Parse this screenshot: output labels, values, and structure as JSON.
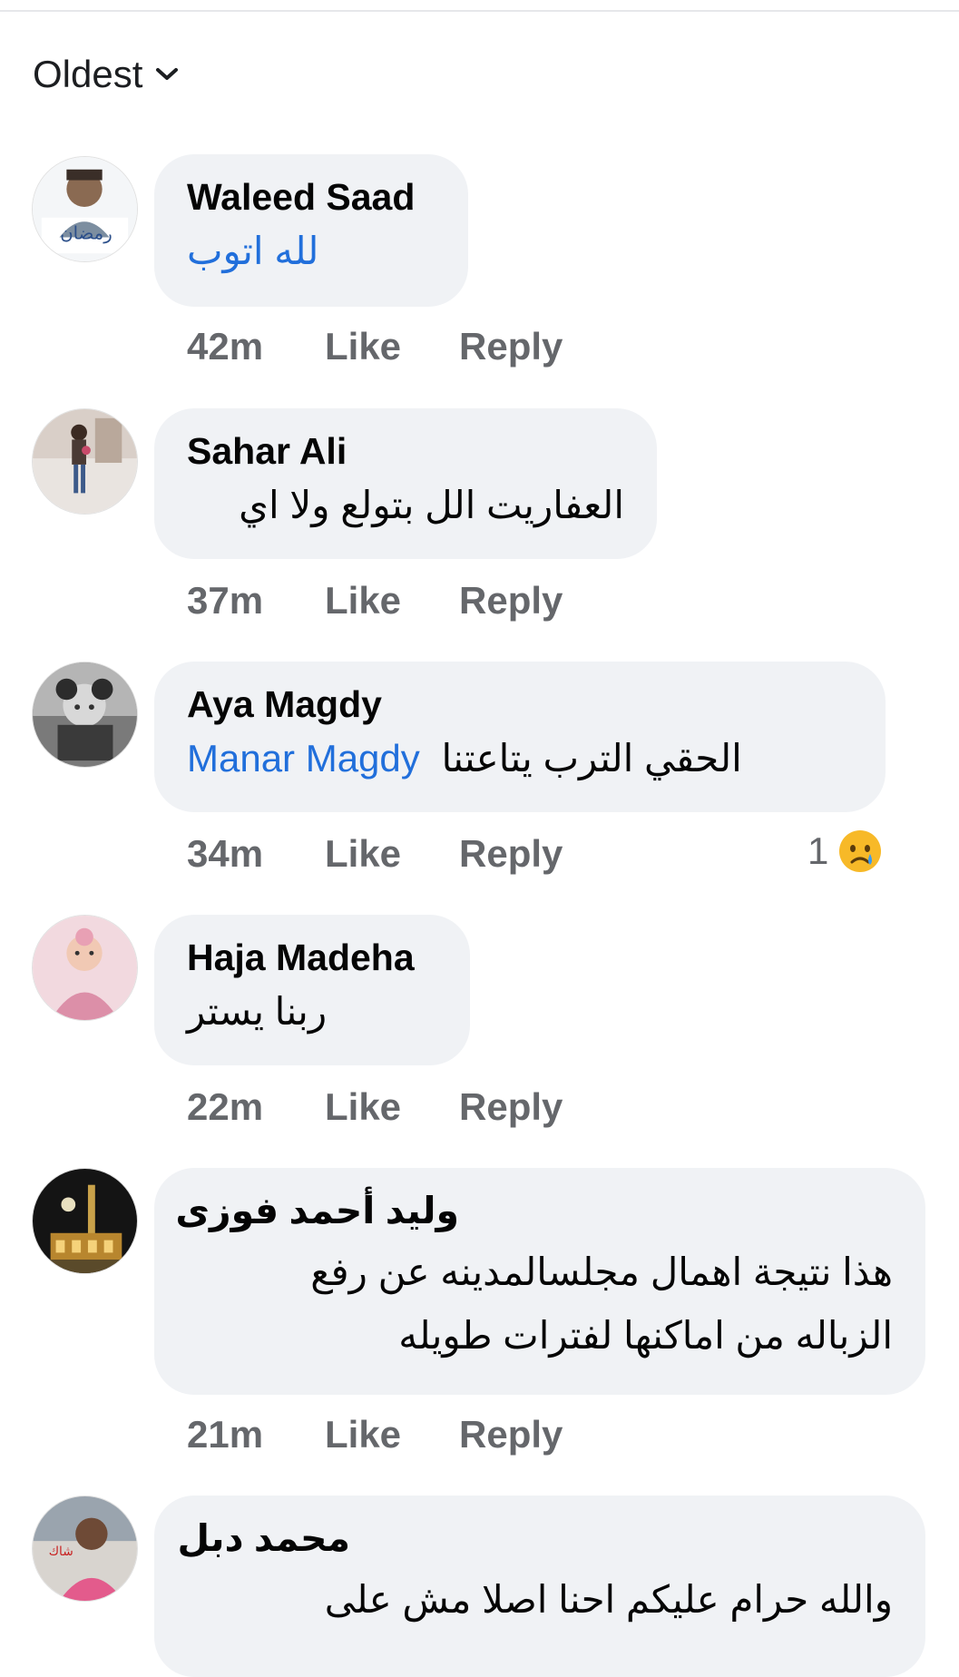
{
  "sort": {
    "label": "Oldest"
  },
  "comments": [
    {
      "name": "Waleed Saad",
      "text": "لله اتوب",
      "time": "42m",
      "like": "Like",
      "reply": "Reply"
    },
    {
      "name": "Sahar Ali",
      "text": "العفاريت الل بتولع ولا اي",
      "time": "37m",
      "like": "Like",
      "reply": "Reply"
    },
    {
      "name": "Aya Magdy",
      "mention": "Manar Magdy",
      "text": "الحقي الترب يتاعتنا",
      "time": "34m",
      "like": "Like",
      "reply": "Reply",
      "reaction_count": "1",
      "reaction_icon": "sad-face-icon"
    },
    {
      "name": "Haja Madeha",
      "text": "ربنا يستر",
      "time": "22m",
      "like": "Like",
      "reply": "Reply"
    },
    {
      "name": "وليد أحمد فوزى",
      "text_line1": "هذا نتيجة اهمال مجلسالمدينه عن رفع",
      "text_line2": "الزباله من اماكنها لفترات طويله",
      "time": "21m",
      "like": "Like",
      "reply": "Reply"
    },
    {
      "name": "محمد دبل",
      "text": "والله حرام عليكم احنا اصلا مش على"
    }
  ],
  "colors": {
    "bubble": "#f0f2f5",
    "mention": "#216fdb",
    "meta": "#65676b"
  }
}
